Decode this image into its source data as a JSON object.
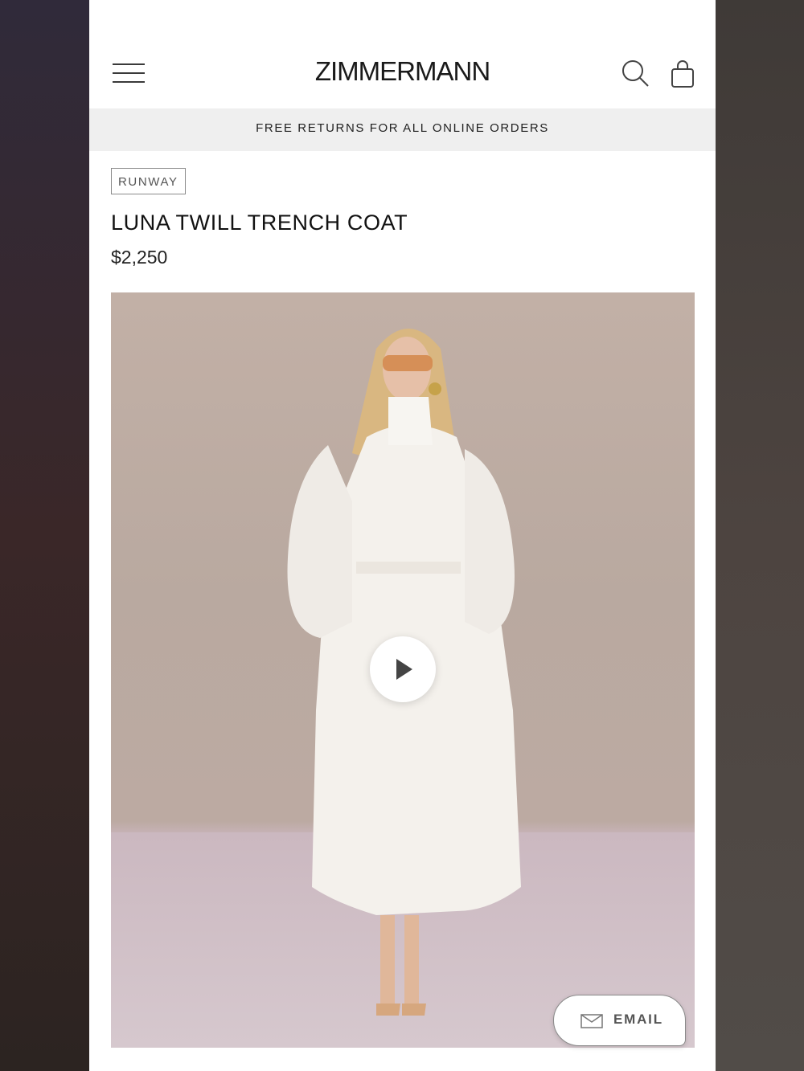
{
  "header": {
    "brand": "ZIMMERMANN",
    "menu_icon": "hamburger-menu-icon",
    "search_icon": "search-icon",
    "bag_icon": "shopping-bag-icon"
  },
  "promo": {
    "text": "FREE RETURNS FOR ALL ONLINE ORDERS"
  },
  "product": {
    "badge": "RUNWAY",
    "title": "LUNA TWILL TRENCH COAT",
    "price": "$2,250"
  },
  "media": {
    "play_icon": "play-icon"
  },
  "email_button": {
    "label": "EMAIL",
    "icon": "mail-icon"
  }
}
